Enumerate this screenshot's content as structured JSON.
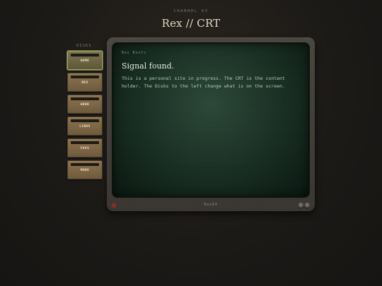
{
  "header": {
    "channel": "CHANNEL 03",
    "title": "Rex // CRT"
  },
  "disks": {
    "label": "DISKS",
    "items": [
      {
        "label": "HOME",
        "active": true
      },
      {
        "label": "REX",
        "active": false
      },
      {
        "label": "WORK",
        "active": false
      },
      {
        "label": "LINKS",
        "active": false
      },
      {
        "label": "FAVS",
        "active": false
      },
      {
        "label": "MORE",
        "active": false
      }
    ]
  },
  "screen": {
    "eyebrow": "Rex Boots",
    "heading": "Signal found.",
    "body": "This is a personal site in progress. The CRT is the content holder. The Disks to the left change what is on the screen."
  },
  "monitor": {
    "brand": "Rex64"
  },
  "colors": {
    "background": "#1c1a17",
    "screen": "#1d3428",
    "disk": "#7d6848",
    "active_disk_border": "#9ea56b",
    "power_led": "#8a2e27"
  }
}
